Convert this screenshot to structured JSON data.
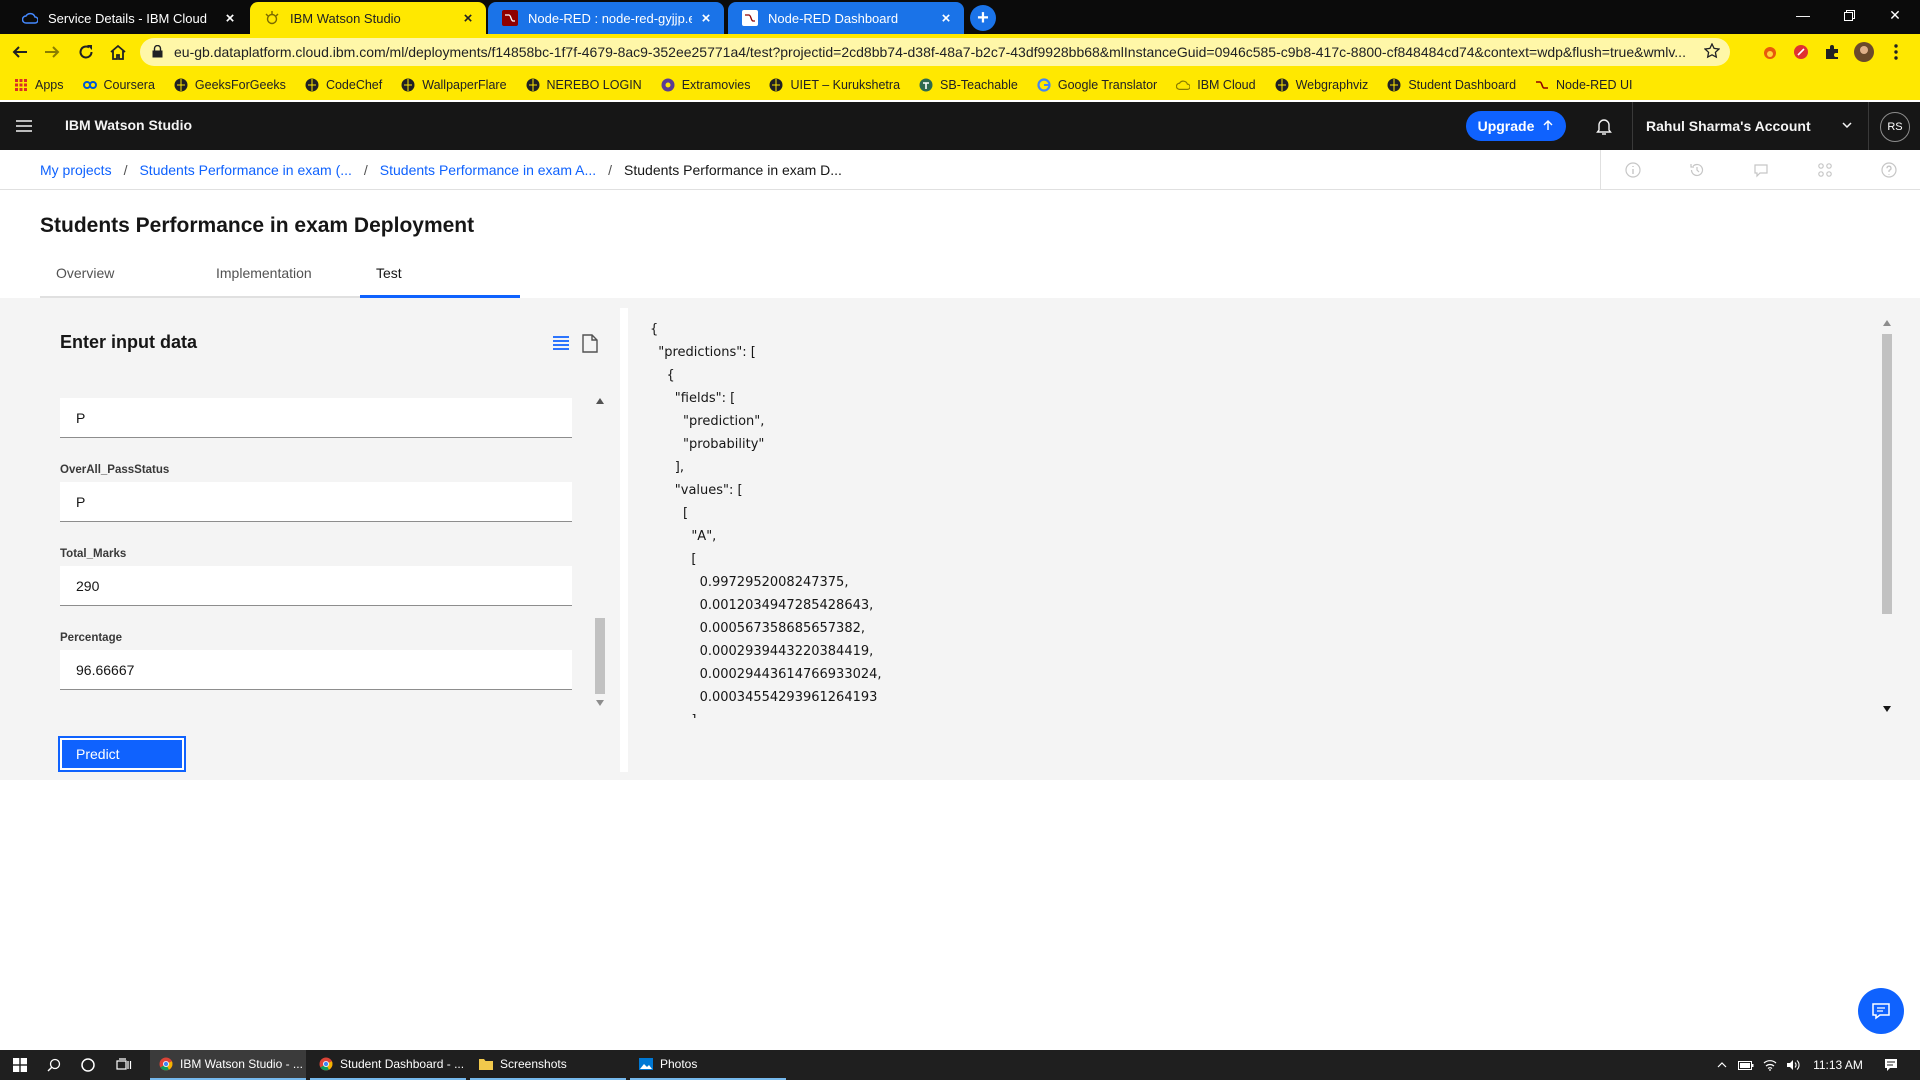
{
  "browser": {
    "tabs": [
      {
        "label": "Service Details - IBM Cloud"
      },
      {
        "label": "IBM Watson Studio"
      },
      {
        "label": "Node-RED : node-red-gyjjp.eu-g"
      },
      {
        "label": "Node-RED Dashboard"
      }
    ],
    "url": "eu-gb.dataplatform.cloud.ibm.com/ml/deployments/f14858bc-1f7f-4679-8ac9-352ee25771a4/test?projectid=2cd8bb74-d38f-48a7-b2c7-43df9928bb68&mlInstanceGuid=0946c585-c9b8-417c-8800-cf848484cd74&context=wdp&flush=true&wmlv...",
    "bookmarks": [
      "Apps",
      "Coursera",
      "GeeksForGeeks",
      "CodeChef",
      "WallpaperFlare",
      "NEREBO LOGIN",
      "Extramovies",
      "UIET – Kurukshetra",
      "SB-Teachable",
      "Google Translator",
      "IBM Cloud",
      "Webgraphviz",
      "Student Dashboard",
      "Node-RED UI"
    ]
  },
  "header": {
    "brand": "IBM Watson Studio",
    "upgrade": "Upgrade",
    "account": "Rahul Sharma's Account",
    "avatar": "RS"
  },
  "breadcrumb": {
    "items": [
      "My projects",
      "Students Performance in exam (...",
      "Students Performance in exam A...",
      "Students Performance in exam D..."
    ]
  },
  "page": {
    "title": "Students Performance in exam Deployment",
    "tabs": [
      "Overview",
      "Implementation",
      "Test"
    ]
  },
  "input_panel": {
    "heading": "Enter input data",
    "fields": [
      {
        "label": "",
        "value": "P"
      },
      {
        "label": "OverAll_PassStatus",
        "value": "P"
      },
      {
        "label": "Total_Marks",
        "value": "290"
      },
      {
        "label": "Percentage",
        "value": "96.66667"
      }
    ],
    "predict_label": "Predict"
  },
  "output": {
    "json_text": "{\n  \"predictions\": [\n    {\n      \"fields\": [\n        \"prediction\",\n        \"probability\"\n      ],\n      \"values\": [\n        [\n          \"A\",\n          [\n            0.9972952008247375,\n            0.0012034947285428643,\n            0.000567358685657382,\n            0.0002939443220384419,\n            0.00029443614766933024,\n            0.00034554293961264193\n          ]"
  },
  "taskbar": {
    "apps": [
      "IBM Watson Studio - ...",
      "Student Dashboard - ...",
      "Screenshots",
      "Photos"
    ],
    "clock": "11:13 AM"
  },
  "colors": {
    "chrome_yellow": "#ffe800",
    "ibm_blue": "#0f62fe",
    "header_black": "#161616"
  }
}
